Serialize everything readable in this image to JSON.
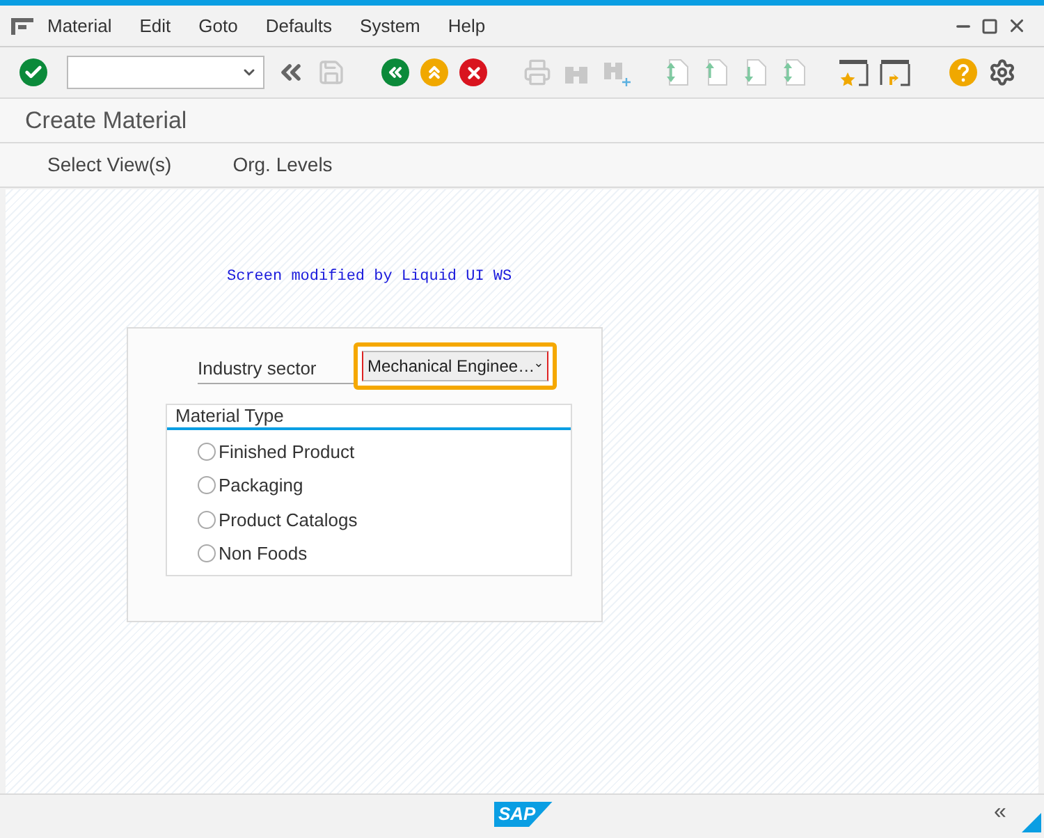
{
  "menu": [
    "Material",
    "Edit",
    "Goto",
    "Defaults",
    "System",
    "Help"
  ],
  "title": "Create Material",
  "app_toolbar": [
    "Select View(s)",
    "Org. Levels"
  ],
  "banner": "Screen modified by Liquid UI WS",
  "industry_sector": {
    "label": "Industry sector",
    "value": "Mechanical Enginee…",
    "highlighted": true
  },
  "material_type": {
    "title": "Material Type",
    "options": [
      {
        "label": "Finished Product",
        "selected": false
      },
      {
        "label": "Packaging",
        "selected": false
      },
      {
        "label": "Product Catalogs",
        "selected": false
      },
      {
        "label": "Non Foods",
        "selected": false
      }
    ]
  },
  "status_bar": {
    "logo": "SAP",
    "collapse": "«"
  }
}
